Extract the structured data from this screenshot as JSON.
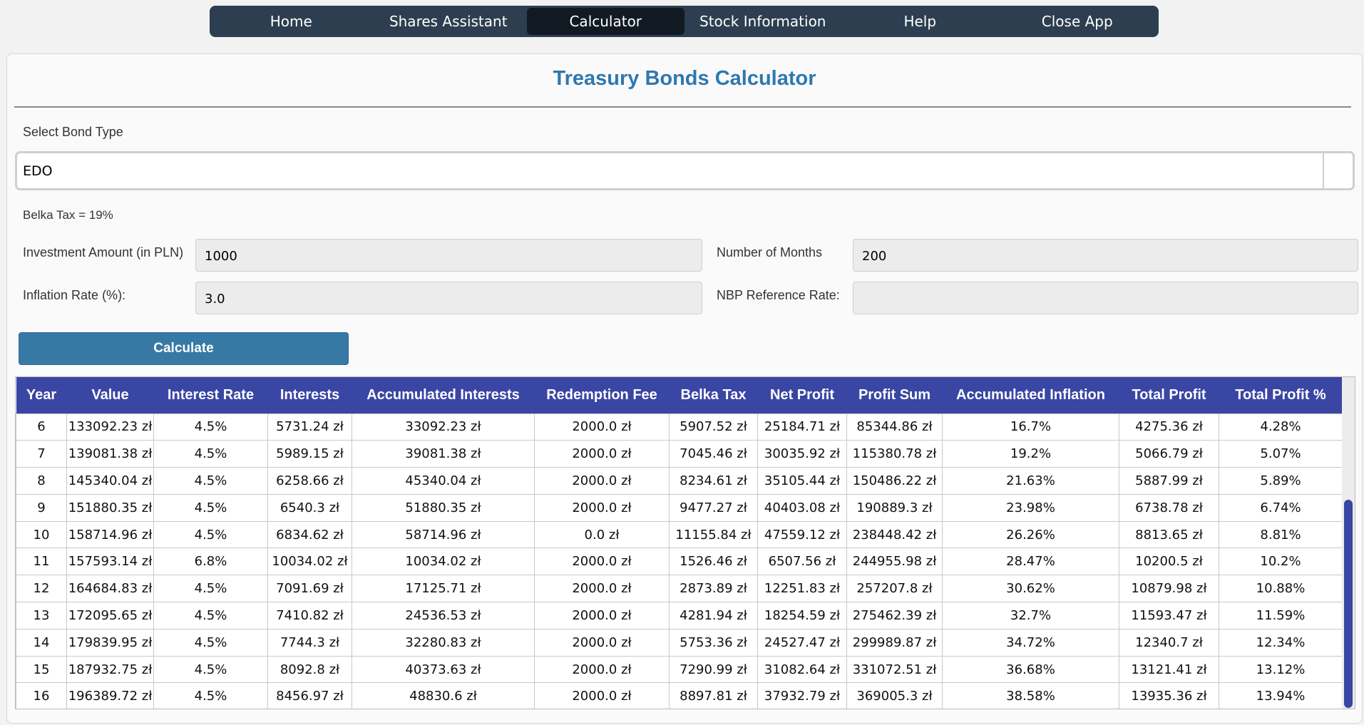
{
  "nav": {
    "items": [
      "Home",
      "Shares Assistant",
      "Calculator",
      "Stock Information",
      "Help",
      "Close App"
    ]
  },
  "page": {
    "title": "Treasury Bonds Calculator",
    "bond_type_label": "Select Bond Type",
    "bond_type_value": "EDO",
    "belka_tax": "Belka Tax = 19%",
    "investment_label": "Investment Amount (in PLN)",
    "investment_value": "1000",
    "months_label": "Number of Months",
    "months_value": "200",
    "inflation_label": "Inflation Rate (%):",
    "inflation_value": "3.0",
    "nbp_label": "NBP Reference Rate:",
    "nbp_value": "",
    "calculate_label": "Calculate"
  },
  "table": {
    "headers": [
      "Year",
      "Value",
      "Interest Rate",
      "Interests",
      "Accumulated Interests",
      "Redemption Fee",
      "Belka Tax",
      "Net Profit",
      "Profit Sum",
      "Accumulated Inflation",
      "Total Profit",
      "Total Profit %"
    ],
    "rows": [
      [
        "6",
        "133092.23 zł",
        "4.5%",
        "5731.24 zł",
        "33092.23 zł",
        "2000.0 zł",
        "5907.52 zł",
        "25184.71 zł",
        "85344.86 zł",
        "16.7%",
        "4275.36 zł",
        "4.28%"
      ],
      [
        "7",
        "139081.38 zł",
        "4.5%",
        "5989.15 zł",
        "39081.38 zł",
        "2000.0 zł",
        "7045.46 zł",
        "30035.92 zł",
        "115380.78 zł",
        "19.2%",
        "5066.79 zł",
        "5.07%"
      ],
      [
        "8",
        "145340.04 zł",
        "4.5%",
        "6258.66 zł",
        "45340.04 zł",
        "2000.0 zł",
        "8234.61 zł",
        "35105.44 zł",
        "150486.22 zł",
        "21.63%",
        "5887.99 zł",
        "5.89%"
      ],
      [
        "9",
        "151880.35 zł",
        "4.5%",
        "6540.3 zł",
        "51880.35 zł",
        "2000.0 zł",
        "9477.27 zł",
        "40403.08 zł",
        "190889.3 zł",
        "23.98%",
        "6738.78 zł",
        "6.74%"
      ],
      [
        "10",
        "158714.96 zł",
        "4.5%",
        "6834.62 zł",
        "58714.96 zł",
        "0.0 zł",
        "11155.84 zł",
        "47559.12 zł",
        "238448.42 zł",
        "26.26%",
        "8813.65 zł",
        "8.81%"
      ],
      [
        "11",
        "157593.14 zł",
        "6.8%",
        "10034.02 zł",
        "10034.02 zł",
        "2000.0 zł",
        "1526.46 zł",
        "6507.56 zł",
        "244955.98 zł",
        "28.47%",
        "10200.5 zł",
        "10.2%"
      ],
      [
        "12",
        "164684.83 zł",
        "4.5%",
        "7091.69 zł",
        "17125.71 zł",
        "2000.0 zł",
        "2873.89 zł",
        "12251.83 zł",
        "257207.8 zł",
        "30.62%",
        "10879.98 zł",
        "10.88%"
      ],
      [
        "13",
        "172095.65 zł",
        "4.5%",
        "7410.82 zł",
        "24536.53 zł",
        "2000.0 zł",
        "4281.94 zł",
        "18254.59 zł",
        "275462.39 zł",
        "32.7%",
        "11593.47 zł",
        "11.59%"
      ],
      [
        "14",
        "179839.95 zł",
        "4.5%",
        "7744.3 zł",
        "32280.83 zł",
        "2000.0 zł",
        "5753.36 zł",
        "24527.47 zł",
        "299989.87 zł",
        "34.72%",
        "12340.7 zł",
        "12.34%"
      ],
      [
        "15",
        "187932.75 zł",
        "4.5%",
        "8092.8 zł",
        "40373.63 zł",
        "2000.0 zł",
        "7290.99 zł",
        "31082.64 zł",
        "331072.51 zł",
        "36.68%",
        "13121.41 zł",
        "13.12%"
      ],
      [
        "16",
        "196389.72 zł",
        "4.5%",
        "8456.97 zł",
        "48830.6 zł",
        "2000.0 zł",
        "8897.81 zł",
        "37932.79 zł",
        "369005.3 zł",
        "38.58%",
        "13935.36 zł",
        "13.94%"
      ]
    ]
  }
}
